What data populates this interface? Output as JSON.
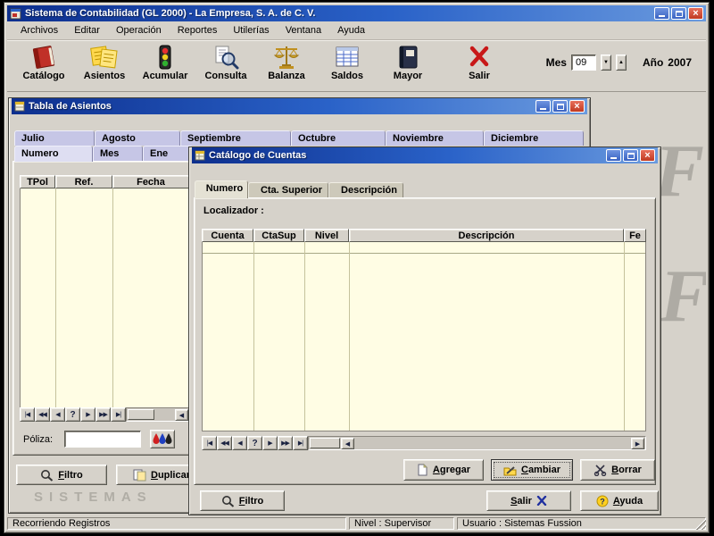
{
  "window": {
    "title": "Sistema de Contabilidad (GL 2000) - La Empresa, S. A. de C. V."
  },
  "controls": {
    "close": "×"
  },
  "glyphs": {
    "left": "◀",
    "right": "▶",
    "up": "▲",
    "down": "▼"
  },
  "menu": {
    "items": [
      "Archivos",
      "Editar",
      "Operación",
      "Reportes",
      "Utilerías",
      "Ventana",
      "Ayuda"
    ]
  },
  "toolbar": {
    "buttons": [
      {
        "label": "Catálogo"
      },
      {
        "label": "Asientos"
      },
      {
        "label": "Acumular"
      },
      {
        "label": "Consulta"
      },
      {
        "label": "Balanza"
      },
      {
        "label": "Saldos"
      },
      {
        "label": "Mayor"
      },
      {
        "label": "Salir"
      }
    ],
    "mes_label": "Mes",
    "mes_value": "09",
    "ano_label": "Año",
    "ano_value": "2007"
  },
  "asientos_window": {
    "title": "Tabla de Asientos",
    "month_tabs": [
      "Julio",
      "Agosto",
      "Septiembre",
      "Octubre",
      "Noviembre",
      "Diciembre"
    ],
    "sub_tabs": [
      "Numero",
      "Mes",
      "Ene"
    ],
    "grid_headers": [
      "TPol",
      "Ref.",
      "Fecha"
    ],
    "nav_buttons": [
      "|◀",
      "◀◀",
      "◀",
      "?",
      "▶",
      "▶▶",
      "▶|"
    ],
    "poliza_label": "Póliza:",
    "buttons": {
      "filtro": "Filtro",
      "duplicar": "Duplicar"
    }
  },
  "catalogo_window": {
    "title": "Catálogo de Cuentas",
    "tabs": [
      "Numero",
      "Cta. Superior",
      "Descripción"
    ],
    "localizador_label": "Localizador :",
    "grid_headers": [
      "Cuenta",
      "CtaSup",
      "Nivel",
      "Descripción",
      "Fe"
    ],
    "nav_buttons": [
      "|◀",
      "◀◀",
      "◀",
      "?",
      "▶",
      "▶▶",
      "▶|"
    ],
    "buttons": {
      "agregar": "Agregar",
      "cambiar": "Cambiar",
      "borrar": "Borrar",
      "filtro": "Filtro",
      "salir": "Salir",
      "ayuda": "Ayuda"
    }
  },
  "statusbar": {
    "panels": [
      "Recorriendo Registros",
      "Nivel : Supervisor",
      "Usuario : Sistemas Fussion"
    ]
  },
  "watermark": {
    "letter": "F",
    "text": "SISTEMAS"
  },
  "colors": {
    "titlebar_start": "#0d2f8e",
    "titlebar_end": "#6a9ade",
    "tab_lavender": "#c6c6e6",
    "grid_body": "#fffde4",
    "close_red": "#c03a22"
  }
}
